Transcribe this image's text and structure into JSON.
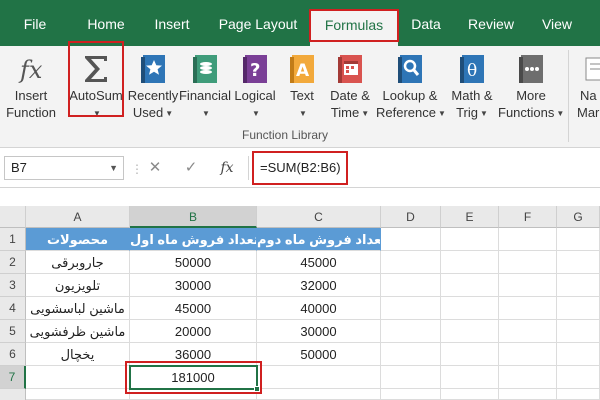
{
  "tabs": [
    {
      "label": "File"
    },
    {
      "label": "Home"
    },
    {
      "label": "Insert"
    },
    {
      "label": "Page Layout"
    },
    {
      "label": "Formulas",
      "active": true
    },
    {
      "label": "Data"
    },
    {
      "label": "Review"
    },
    {
      "label": "View"
    }
  ],
  "ribbon": {
    "buttons": [
      {
        "line1": "Insert",
        "line2": "Function",
        "icon": "fx-icon"
      },
      {
        "line1": "AutoSum",
        "line2": "",
        "icon": "sigma-icon"
      },
      {
        "line1": "Recently",
        "line2": "Used",
        "icon": "star-book-icon"
      },
      {
        "line1": "Financial",
        "line2": "",
        "icon": "money-book-icon"
      },
      {
        "line1": "Logical",
        "line2": "",
        "icon": "question-book-icon"
      },
      {
        "line1": "Text",
        "line2": "",
        "icon": "text-book-icon"
      },
      {
        "line1": "Date &",
        "line2": "Time",
        "icon": "calendar-book-icon"
      },
      {
        "line1": "Lookup &",
        "line2": "Reference",
        "icon": "lookup-book-icon"
      },
      {
        "line1": "Math &",
        "line2": "Trig",
        "icon": "theta-book-icon"
      },
      {
        "line1": "More",
        "line2": "Functions",
        "icon": "more-book-icon"
      },
      {
        "line1": "Na",
        "line2": "Mar",
        "icon": "name-manager-icon"
      }
    ],
    "group_label": "Function Library"
  },
  "formula_bar": {
    "name_box": "B7",
    "cancel": "✕",
    "enter": "✓",
    "fx": "fx",
    "formula": "=SUM(B2:B6)"
  },
  "sheet": {
    "columns": [
      "A",
      "B",
      "C",
      "D",
      "E",
      "F",
      "G"
    ],
    "rows": [
      "1",
      "2",
      "3",
      "4",
      "5",
      "6",
      "7"
    ],
    "selected_cell": "B7",
    "cells": [
      [
        "محصولات",
        "تعداد فروش ماه اول",
        "تعداد فروش ماه دوم"
      ],
      [
        "جاروبرقی",
        "50000",
        "45000"
      ],
      [
        "تلویزیون",
        "30000",
        "32000"
      ],
      [
        "ماشین لباسشویی",
        "45000",
        "40000"
      ],
      [
        "ماشین ظرفشویی",
        "20000",
        "30000"
      ],
      [
        "یخچال",
        "36000",
        "50000"
      ],
      [
        "",
        "181000",
        ""
      ]
    ]
  },
  "colors": {
    "accent": "#217346",
    "header_fill": "#5b9bd5",
    "highlight": "#d02020"
  }
}
